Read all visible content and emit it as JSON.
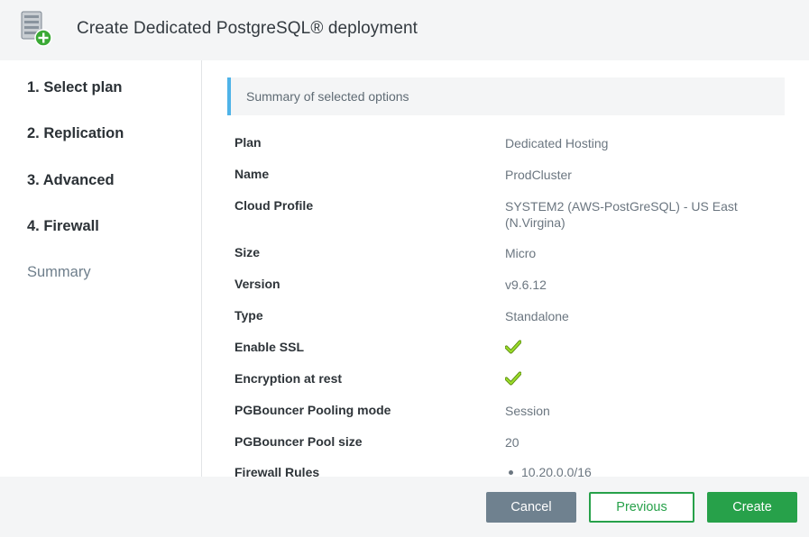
{
  "header": {
    "title": "Create Dedicated PostgreSQL® deployment",
    "icon": "server-add-icon"
  },
  "sidebar": {
    "steps": [
      {
        "label": "1. Select plan"
      },
      {
        "label": "2. Replication"
      },
      {
        "label": "3. Advanced"
      },
      {
        "label": "4. Firewall"
      },
      {
        "label": "Summary",
        "active": true
      }
    ]
  },
  "summary": {
    "banner": "Summary of selected options",
    "rows": [
      {
        "label": "Plan",
        "value": "Dedicated Hosting"
      },
      {
        "label": "Name",
        "value": "ProdCluster"
      },
      {
        "label": "Cloud Profile",
        "value": "SYSTEM2 (AWS-PostGreSQL) - US East (N.Virgina)"
      },
      {
        "label": "Size",
        "value": "Micro"
      },
      {
        "label": "Version",
        "value": "v9.6.12"
      },
      {
        "label": "Type",
        "value": "Standalone"
      },
      {
        "label": "Enable SSL",
        "value": true
      },
      {
        "label": "Encryption at rest",
        "value": true
      },
      {
        "label": "PGBouncer Pooling mode",
        "value": "Session"
      },
      {
        "label": "PGBouncer Pool size",
        "value": "20"
      },
      {
        "label": "Firewall Rules",
        "items": [
          "10.20.0.0/16"
        ]
      }
    ]
  },
  "footer": {
    "cancel": "Cancel",
    "previous": "Previous",
    "create": "Create"
  },
  "colors": {
    "accent_green": "#27a14a",
    "banner_accent": "#4fb3e8",
    "cancel_gray": "#6f818f",
    "check_green": "#8ccf1e"
  }
}
